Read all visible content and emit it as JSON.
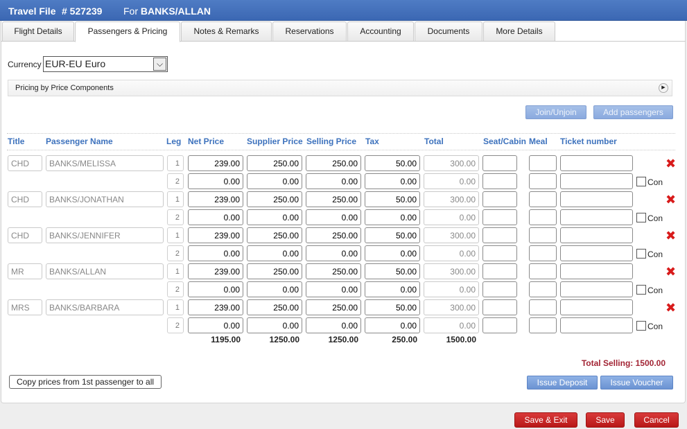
{
  "header": {
    "title": "Travel File",
    "file_number": "# 527239",
    "for_label": "For",
    "client": "BANKS/ALLAN"
  },
  "tabs": [
    "Flight Details",
    "Passengers & Pricing",
    "Notes & Remarks",
    "Reservations",
    "Accounting",
    "Documents",
    "More Details"
  ],
  "active_tab": "Passengers & Pricing",
  "currency": {
    "label": "Currency",
    "value": "EUR-EU Euro"
  },
  "pricing_section": {
    "label": "Pricing by Price Components"
  },
  "actions": {
    "join_unjoin": "Join/Unjoin",
    "add_passengers": "Add passengers"
  },
  "columns": {
    "title": "Title",
    "name": "Passenger Name",
    "leg": "Leg",
    "net": "Net Price",
    "supplier": "Supplier Price",
    "selling": "Selling Price",
    "tax": "Tax",
    "total": "Total",
    "seat": "Seat/Cabin",
    "meal": "Meal",
    "ticket": "Ticket number"
  },
  "passengers": [
    {
      "title": "CHD",
      "name": "BANKS/MELISSA",
      "legs": [
        {
          "leg": "1",
          "net": "239.00",
          "supplier": "250.00",
          "selling": "250.00",
          "tax": "50.00",
          "total": "300.00"
        },
        {
          "leg": "2",
          "net": "0.00",
          "supplier": "0.00",
          "selling": "0.00",
          "tax": "0.00",
          "total": "0.00"
        }
      ]
    },
    {
      "title": "CHD",
      "name": "BANKS/JONATHAN",
      "legs": [
        {
          "leg": "1",
          "net": "239.00",
          "supplier": "250.00",
          "selling": "250.00",
          "tax": "50.00",
          "total": "300.00"
        },
        {
          "leg": "2",
          "net": "0.00",
          "supplier": "0.00",
          "selling": "0.00",
          "tax": "0.00",
          "total": "0.00"
        }
      ]
    },
    {
      "title": "CHD",
      "name": "BANKS/JENNIFER",
      "legs": [
        {
          "leg": "1",
          "net": "239.00",
          "supplier": "250.00",
          "selling": "250.00",
          "tax": "50.00",
          "total": "300.00"
        },
        {
          "leg": "2",
          "net": "0.00",
          "supplier": "0.00",
          "selling": "0.00",
          "tax": "0.00",
          "total": "0.00"
        }
      ]
    },
    {
      "title": "MR",
      "name": "BANKS/ALLAN",
      "legs": [
        {
          "leg": "1",
          "net": "239.00",
          "supplier": "250.00",
          "selling": "250.00",
          "tax": "50.00",
          "total": "300.00"
        },
        {
          "leg": "2",
          "net": "0.00",
          "supplier": "0.00",
          "selling": "0.00",
          "tax": "0.00",
          "total": "0.00"
        }
      ]
    },
    {
      "title": "MRS",
      "name": "BANKS/BARBARA",
      "legs": [
        {
          "leg": "1",
          "net": "239.00",
          "supplier": "250.00",
          "selling": "250.00",
          "tax": "50.00",
          "total": "300.00"
        },
        {
          "leg": "2",
          "net": "0.00",
          "supplier": "0.00",
          "selling": "0.00",
          "tax": "0.00",
          "total": "0.00"
        }
      ]
    }
  ],
  "con_label": "Con",
  "totals": {
    "net": "1195.00",
    "supplier": "1250.00",
    "selling": "1250.00",
    "tax": "250.00",
    "total": "1500.00"
  },
  "total_selling": "Total Selling: 1500.00",
  "bottom_actions": {
    "copy_prices": "Copy prices from 1st passenger to all",
    "issue_deposit": "Issue Deposit",
    "issue_voucher": "Issue Voucher"
  },
  "footer": {
    "save_exit": "Save & Exit",
    "save": "Save",
    "cancel": "Cancel"
  },
  "colors": {
    "header_blue": "#3b67b3",
    "column_blue": "#3d72bd",
    "delete_red": "#d81b1b",
    "total_red": "#a22434"
  }
}
